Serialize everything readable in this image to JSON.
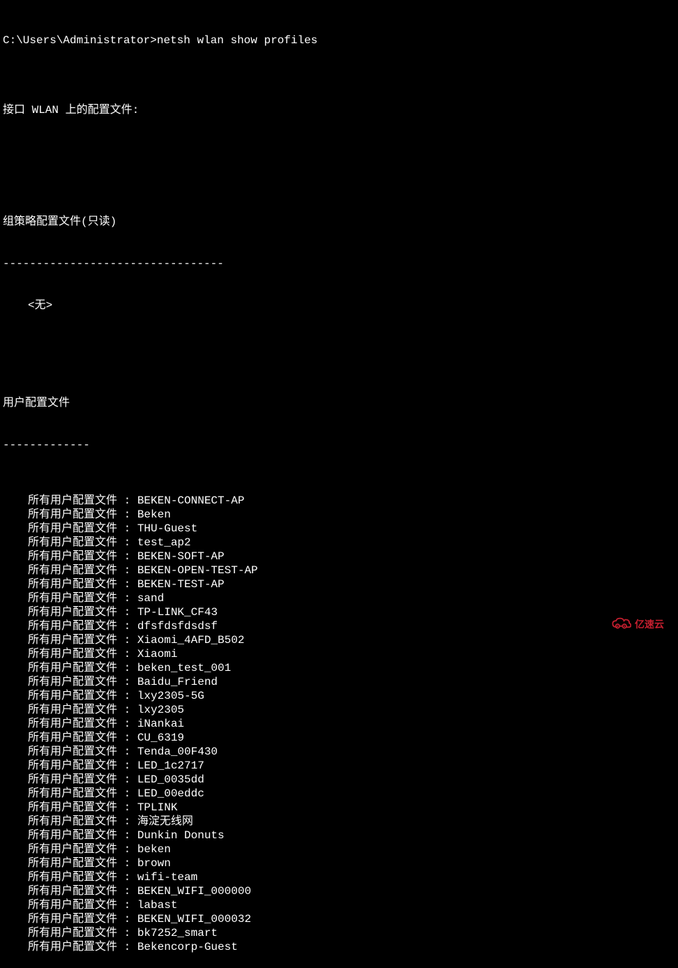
{
  "prompt": {
    "path": "C:\\Users\\Administrator>",
    "command": "netsh wlan show profiles"
  },
  "interface_line": "接口 WLAN 上的配置文件:",
  "group_policy": {
    "header": "组策略配置文件(只读)",
    "divider": "---------------------------------",
    "empty": "<无>"
  },
  "user_profiles": {
    "header": "用户配置文件",
    "divider": "-------------",
    "label": "所有用户配置文件 : ",
    "items": [
      "BEKEN-CONNECT-AP",
      "Beken",
      "THU-Guest",
      "test_ap2",
      "BEKEN-SOFT-AP",
      "BEKEN-OPEN-TEST-AP",
      "BEKEN-TEST-AP",
      "sand",
      "TP-LINK_CF43",
      "dfsfdsfdsdsf",
      "Xiaomi_4AFD_B502",
      "Xiaomi",
      "beken_test_001",
      "Baidu_Friend",
      "lxy2305-5G",
      "lxy2305",
      "iNankai",
      "CU_6319",
      "Tenda_00F430",
      "LED_1c2717",
      "LED_0035dd",
      "LED_00eddc",
      "TPLINK",
      "海淀无线网",
      "Dunkin Donuts",
      "beken",
      "brown",
      "wifi-team",
      "BEKEN_WIFI_000000",
      "labast",
      "BEKEN_WIFI_000032",
      "bk7252_smart",
      "Bekencorp-Guest"
    ]
  },
  "watermark": {
    "text": "亿速云"
  }
}
